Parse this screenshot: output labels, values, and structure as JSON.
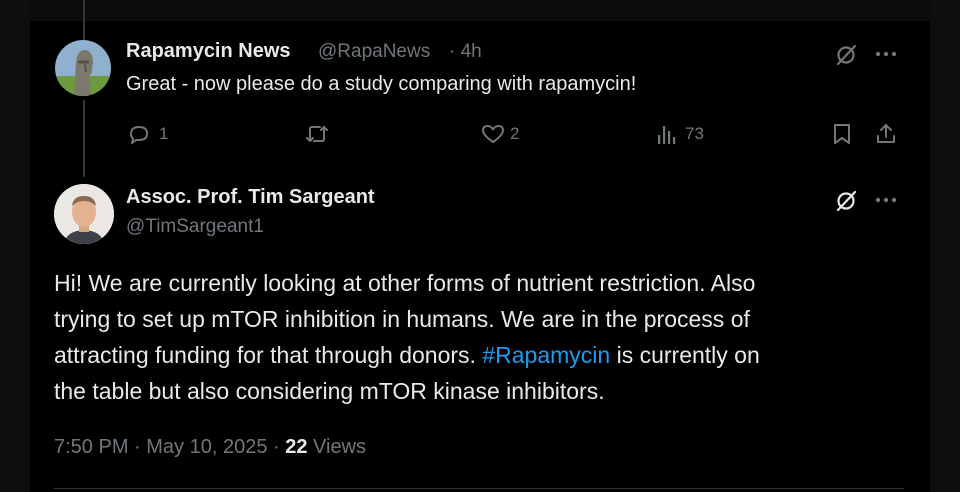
{
  "reply_tweet": {
    "author_name": "Rapamycin News",
    "handle": "@RapaNews",
    "time": "· 4h",
    "text": "Great - now please do a study comparing with rapamycin!",
    "reply_count": "1",
    "retweet_count": "",
    "like_count": "2",
    "view_count": "73"
  },
  "main_tweet": {
    "author_name": "Assoc. Prof. Tim Sargeant",
    "handle": "@TimSargeant1",
    "lines": [
      "Hi! We are currently looking at other forms of nutrient restriction. Also",
      "trying to set up mTOR inhibition in humans. We are in the process of",
      "attracting funding for that through donors.",
      "#Rapamycin",
      "is currently on",
      "the table but also considering mTOR kinase inhibitors."
    ],
    "timestamp": "7:50 PM · May 10, 2025 ·",
    "views_count": "22",
    "views_label": "Views"
  },
  "colors": {
    "background": "#000000",
    "text_primary": "#e7e9ea",
    "text_secondary": "#71767b",
    "link": "#1d9bf0",
    "thread_line": "#333639"
  },
  "icons": {
    "grok": "grok-icon",
    "more": "more-icon",
    "reply": "reply-icon",
    "retweet": "retweet-icon",
    "like": "heart-icon",
    "views": "views-icon",
    "bookmark": "bookmark-icon",
    "share": "share-icon"
  }
}
